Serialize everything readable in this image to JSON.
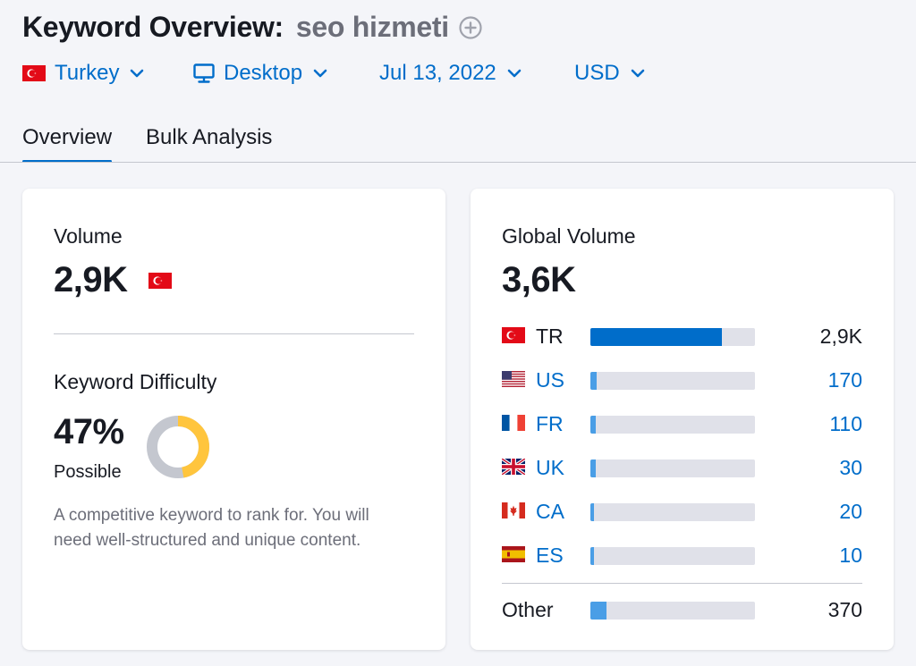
{
  "header": {
    "title": "Keyword Overview:",
    "keyword": "seo hizmeti"
  },
  "filters": {
    "country": "Turkey",
    "device": "Desktop",
    "date": "Jul 13, 2022",
    "currency": "USD"
  },
  "tabs": [
    {
      "label": "Overview",
      "active": true
    },
    {
      "label": "Bulk Analysis",
      "active": false
    }
  ],
  "volume": {
    "label": "Volume",
    "value": "2,9K"
  },
  "difficulty": {
    "label": "Keyword Difficulty",
    "value": "47%",
    "percent": 47,
    "level": "Possible",
    "description": "A competitive keyword to rank for. You will need well-structured and unique content.",
    "colors": {
      "filled": "#ffc53d",
      "empty": "#c4c7cf"
    }
  },
  "global_volume": {
    "label": "Global Volume",
    "value": "3,6K",
    "countries": [
      {
        "code": "TR",
        "flag": "turkey-flag",
        "value": "2,9K",
        "share": 0.8,
        "link": false,
        "bar_color": "#006dca"
      },
      {
        "code": "US",
        "flag": "usa-flag",
        "value": "170",
        "share": 0.04,
        "link": true,
        "bar_color": "#4a9ee6"
      },
      {
        "code": "FR",
        "flag": "france-flag",
        "value": "110",
        "share": 0.03,
        "link": true,
        "bar_color": "#4a9ee6"
      },
      {
        "code": "UK",
        "flag": "uk-flag",
        "value": "30",
        "share": 0.03,
        "link": true,
        "bar_color": "#4a9ee6"
      },
      {
        "code": "CA",
        "flag": "canada-flag",
        "value": "20",
        "share": 0.02,
        "link": true,
        "bar_color": "#4a9ee6"
      },
      {
        "code": "ES",
        "flag": "spain-flag",
        "value": "10",
        "share": 0.02,
        "link": true,
        "bar_color": "#4a9ee6"
      }
    ],
    "other": {
      "code": "Other",
      "value": "370",
      "share": 0.1,
      "bar_color": "#4a9ee6"
    }
  }
}
